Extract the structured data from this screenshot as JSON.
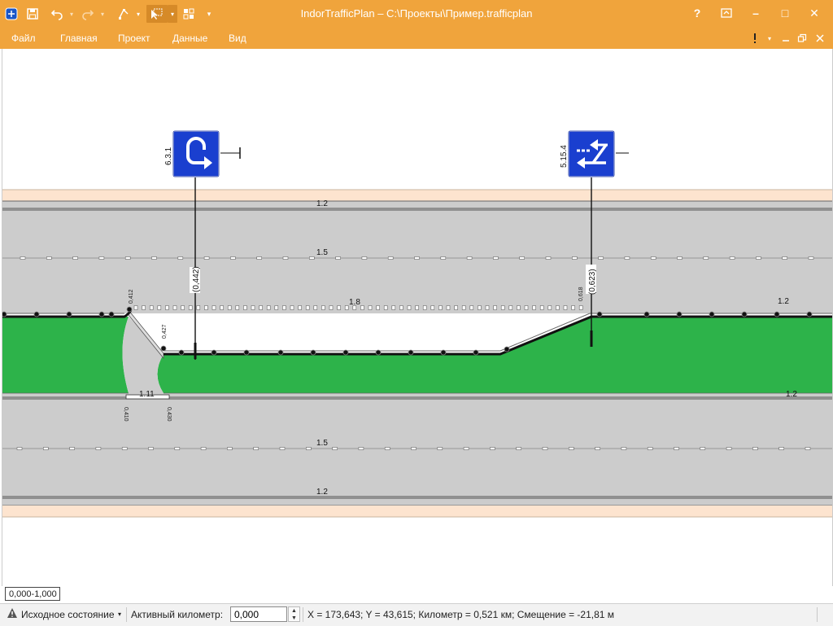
{
  "app": {
    "title": "IndorTrafficPlan – C:\\Проекты\\Пример.trafficplan"
  },
  "window_buttons": {
    "help": "?",
    "restore_icon": "ribbon-display-icon",
    "minimize": "–",
    "maximize": "□",
    "close": "✕"
  },
  "menu": {
    "items": [
      "Файл",
      "Главная",
      "Проект",
      "Данные",
      "Вид"
    ]
  },
  "canvas": {
    "signs": [
      {
        "code": "6.3.1",
        "offset": "(0,442)"
      },
      {
        "code": "5.15.4",
        "offset": "(0,623)"
      }
    ],
    "markings": {
      "top_edge": "1.2",
      "top_lane": "1.5",
      "median_dash": "1.8",
      "right_edge": "1.2",
      "island_edge": "1.2",
      "bottom_lane": "1.5",
      "bottom_edge": "1.2",
      "crossing": "1.11"
    },
    "dims": {
      "d1": "0,412",
      "d2": "0,427",
      "d3": "0,618",
      "d4": "0,410",
      "d5": "0,430"
    },
    "colors": {
      "road": "#cccccc",
      "median": "#2db34a",
      "sign": "#1a3fcf",
      "shoulder": "#fde4cf"
    }
  },
  "zoom_range": "0,000-1,000",
  "status": {
    "state_label": "Исходное состояние",
    "km_label": "Активный километр:",
    "km_value": "0,000",
    "coords": "X = 173,643; Y = 43,615; Километр = 0,521 км; Смещение = -21,81 м"
  }
}
